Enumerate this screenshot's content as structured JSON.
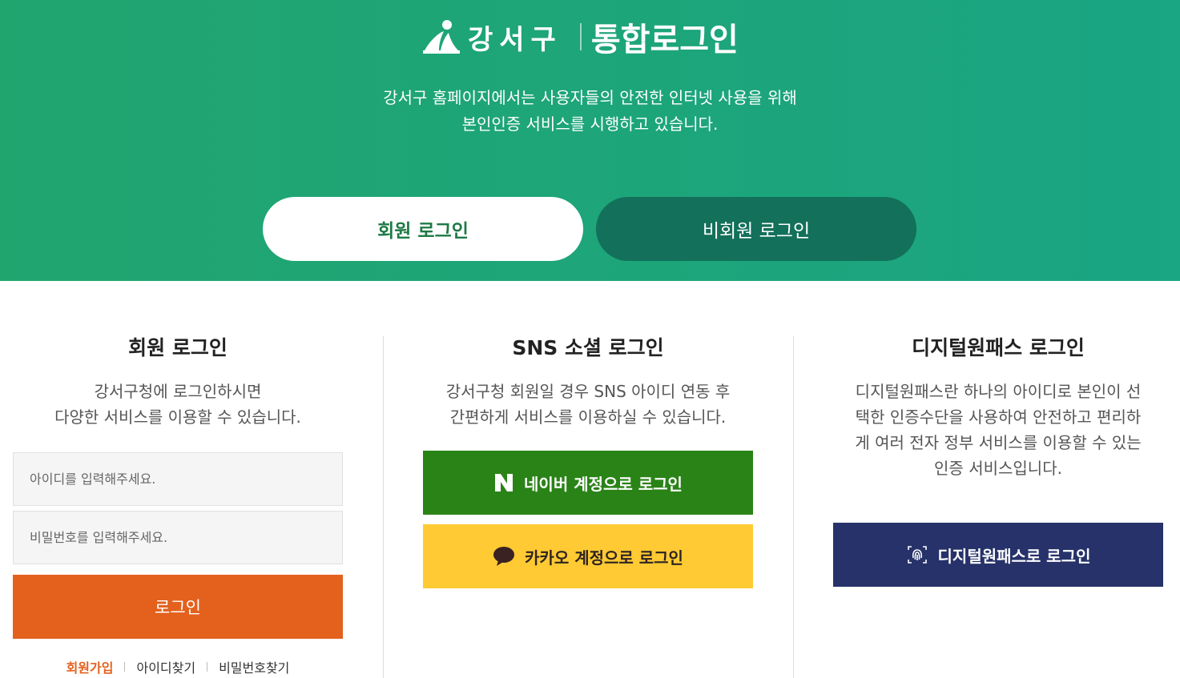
{
  "header": {
    "logo_text": "강서구",
    "title": "통합로그인",
    "desc_line1": "강서구 홈페이지에서는 사용자들의 안전한 인터넷 사용을 위해",
    "desc_line2": "본인인증 서비스를 시행하고 있습니다."
  },
  "tabs": {
    "member": "회원 로그인",
    "guest": "비회원 로그인"
  },
  "member_login": {
    "title": "회원 로그인",
    "desc_line1": "강서구청에 로그인하시면",
    "desc_line2": "다양한 서비스를 이용할 수 있습니다.",
    "id_placeholder": "아이디를 입력해주세요.",
    "pw_placeholder": "비밀번호를 입력해주세요.",
    "login_button": "로그인",
    "links": {
      "join": "회원가입",
      "find_id": "아이디찾기",
      "find_pw": "비밀번호찾기"
    }
  },
  "sns_login": {
    "title": "SNS 소셜 로그인",
    "desc_line1": "강서구청 회원일 경우 SNS 아이디 연동 후",
    "desc_line2": "간편하게 서비스를 이용하실 수 있습니다.",
    "naver_button": "네이버 계정으로 로그인",
    "kakao_button": "카카오 계정으로 로그인"
  },
  "digital_login": {
    "title": "디지털원패스 로그인",
    "desc_line1": "디지털원패스란 하나의 아이디로 본인이 선",
    "desc_line2": "택한 인증수단을 사용하여 안전하고 편리하",
    "desc_line3": "게 여러 전자 정부 서비스를 이용할 수 있는",
    "desc_line4": "인증 서비스입니다.",
    "button": "디지털원패스로 로그인"
  },
  "colors": {
    "hero_green": "#21a56f",
    "guest_tab": "#13705a",
    "login_orange": "#e3611d",
    "naver_green": "#2a8317",
    "kakao_yellow": "#ffca33",
    "onepass_navy": "#263269"
  },
  "icons": {
    "logo": "gangseo-logo-icon",
    "naver": "naver-icon",
    "kakao": "kakao-bubble-icon",
    "onepass": "fingerprint-icon"
  }
}
